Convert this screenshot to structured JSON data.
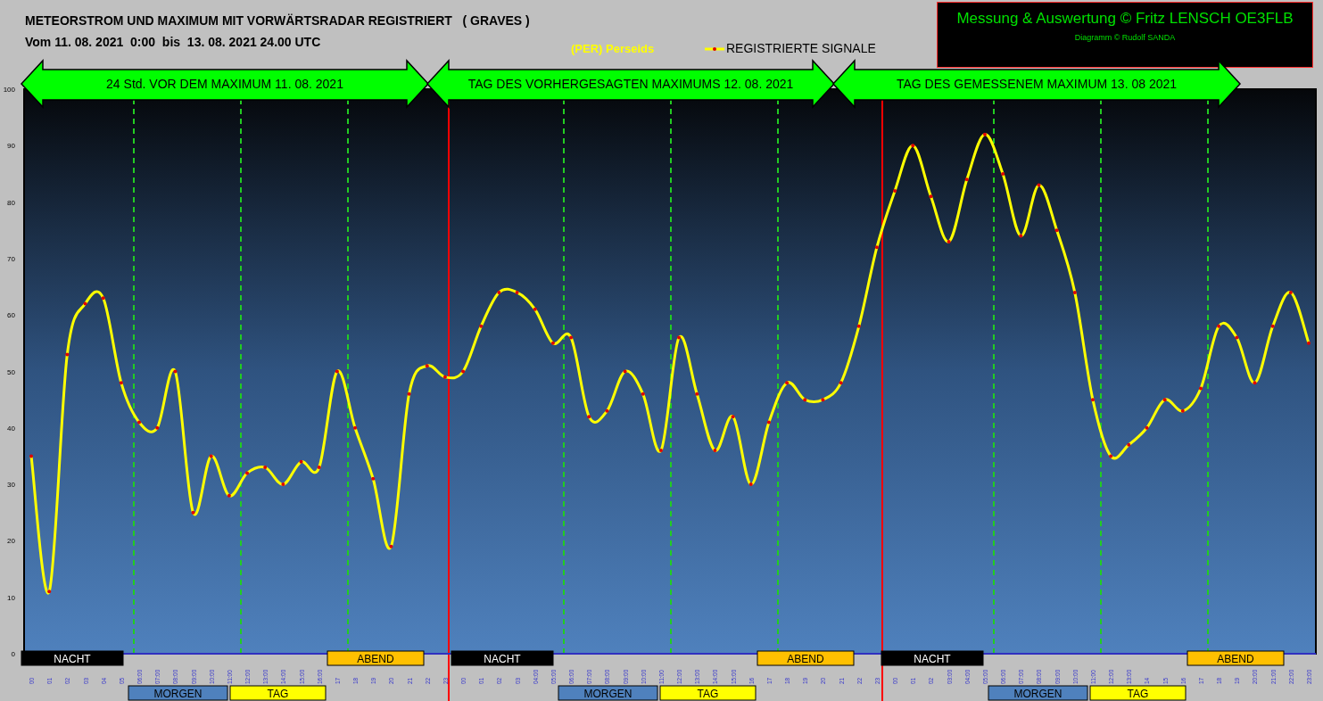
{
  "title": "METEORSTROM UND MAXIMUM MIT VORWÄRTSRADAR REGISTRIERT   ( GRAVES )",
  "subtitle": "Vom 11. 08. 2021  0:00  bis  13. 08. 2021 24.00 UTC",
  "shower": "(PER) Perseids",
  "credits": {
    "main": "Messung & Auswertung © Fritz LENSCH OE3FLB",
    "sub": "Diagramm © Rudolf SANDA"
  },
  "day_arrows": [
    {
      "label": "24 Std. VOR DEM MAXIMUM  11. 08. 2021"
    },
    {
      "label": "TAG DES VORHERGESAGTEN MAXIMUMS 12. 08. 2021"
    },
    {
      "label": "TAG DES GEMESSENEM MAXIMUM 13. 08 2021"
    }
  ],
  "periods": [
    {
      "kind": "nacht",
      "label": "NACHT"
    },
    {
      "kind": "morgen",
      "label": "MORGEN"
    },
    {
      "kind": "tag",
      "label": "TAG"
    },
    {
      "kind": "abend",
      "label": "ABEND"
    },
    {
      "kind": "nacht",
      "label": "NACHT"
    },
    {
      "kind": "morgen",
      "label": "MORGEN"
    },
    {
      "kind": "tag",
      "label": "TAG"
    },
    {
      "kind": "abend",
      "label": "ABEND"
    },
    {
      "kind": "nacht",
      "label": "NACHT"
    },
    {
      "kind": "morgen",
      "label": "MORGEN"
    },
    {
      "kind": "tag",
      "label": "TAG"
    },
    {
      "kind": "abend",
      "label": "ABEND"
    }
  ],
  "chart_data": {
    "type": "line",
    "ylim": [
      0,
      100
    ],
    "yticks": [
      0,
      10,
      20,
      30,
      40,
      50,
      60,
      70,
      80,
      90,
      100
    ],
    "categories": [
      "00",
      "01",
      "02",
      "03",
      "04",
      "05",
      "06:00",
      "07:00",
      "08:00",
      "09:00",
      "10:00",
      "11:00",
      "12:00",
      "13:00",
      "14:00",
      "15:00",
      "16:00",
      "17",
      "18",
      "19",
      "20",
      "21",
      "22",
      "23",
      "00",
      "01",
      "02",
      "03",
      "04:00",
      "05:00",
      "06:00",
      "07:00",
      "08:00",
      "09:00",
      "10:00",
      "11:00",
      "12:00",
      "13:00",
      "14:00",
      "15:00",
      "16",
      "17",
      "18",
      "19",
      "20",
      "21",
      "22",
      "23",
      "00",
      "01",
      "02",
      "03:00",
      "04:00",
      "05:00",
      "06:00",
      "07:00",
      "08:00",
      "09:00",
      "10:00",
      "11:00",
      "12:00",
      "13:00",
      "14",
      "15",
      "16",
      "17",
      "18",
      "19",
      "20:00",
      "21:00",
      "22:00",
      "23:00"
    ],
    "series": [
      {
        "name": "REGISTRIERTE SIGNALE",
        "color": "#ffff00",
        "values": [
          35,
          11,
          53,
          62,
          63,
          48,
          41,
          40,
          50,
          25,
          35,
          28,
          32,
          33,
          30,
          34,
          33,
          50,
          40,
          31,
          19,
          46,
          51,
          49,
          50,
          58,
          64,
          64,
          61,
          55,
          56,
          42,
          43,
          50,
          46,
          36,
          56,
          46,
          36,
          42,
          30,
          41,
          48,
          45,
          45,
          48,
          58,
          72,
          82,
          90,
          81,
          73,
          84,
          92,
          85,
          74,
          83,
          75,
          64,
          45,
          35,
          37,
          40,
          45,
          43,
          47,
          58,
          56,
          48,
          58,
          64,
          55
        ]
      }
    ]
  }
}
